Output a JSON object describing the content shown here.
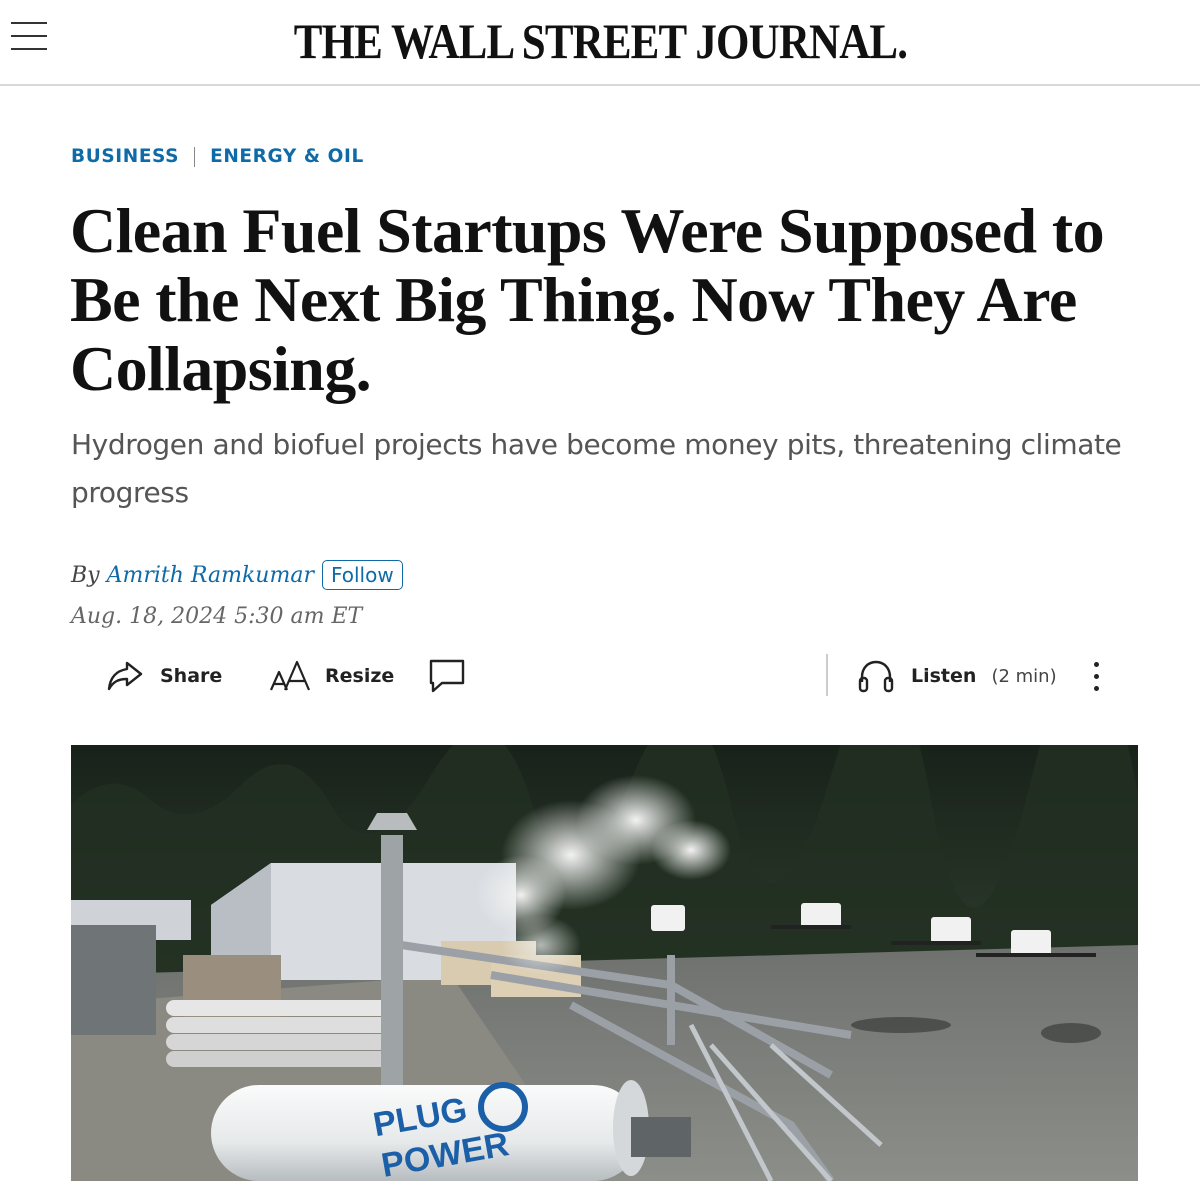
{
  "header": {
    "masthead": "THE WALL STREET JOURNAL.",
    "menu_icon": "hamburger-menu-icon"
  },
  "article": {
    "sections": [
      "BUSINESS",
      "ENERGY & OIL"
    ],
    "headline": "Clean Fuel Startups Were Supposed to Be the Next Big Thing. Now They Are Collapsing.",
    "dek": "Hydrogen and biofuel projects have become money pits, threatening climate progress",
    "byline_prefix": "By",
    "author": "Amrith Ramkumar",
    "follow_label": "Follow",
    "date": "Aug. 18, 2024 5:30 am ET"
  },
  "toolbar": {
    "share_label": "Share",
    "resize_label": "Resize",
    "listen_label": "Listen",
    "listen_duration": "(2 min)",
    "icons": [
      "share-icon",
      "resize-icon",
      "comment-icon",
      "headphones-icon",
      "more-options-icon"
    ]
  },
  "photo": {
    "tank_brand_line1": "PLUG",
    "tank_brand_line2": "POWER",
    "colors": {
      "sky_trees": "#1f2a1f",
      "pavement": "#7a7d78",
      "tank": "#eef0f0",
      "brand": "#1b5fa8"
    }
  }
}
